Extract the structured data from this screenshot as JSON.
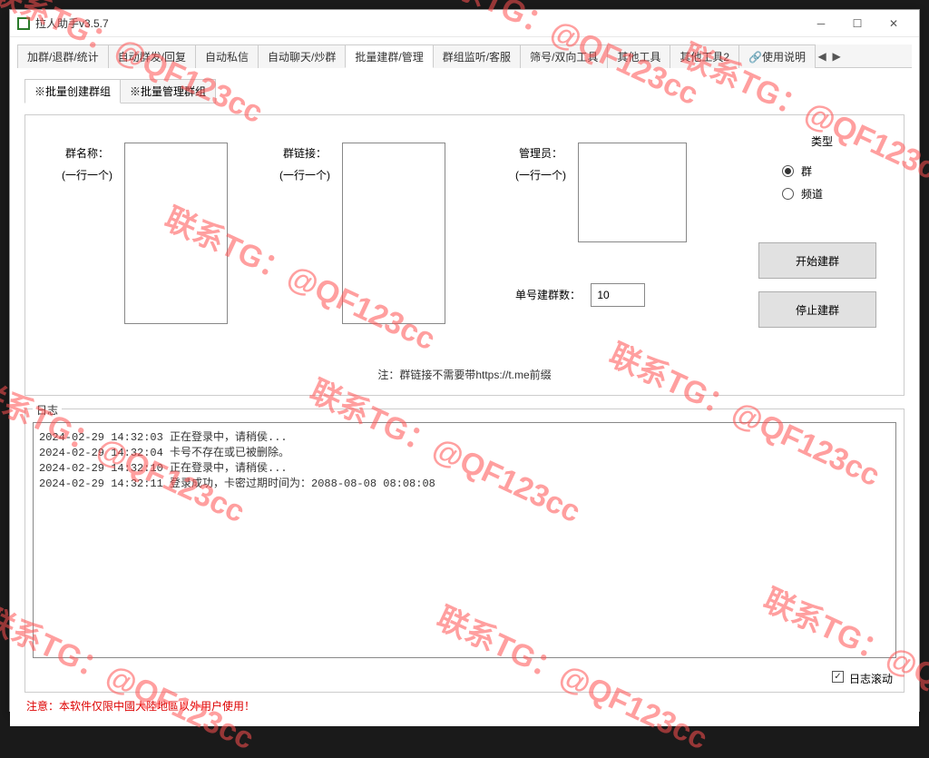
{
  "window": {
    "title": "拉人助手v3.5.7"
  },
  "tabs": [
    "加群/退群/统计",
    "自动群发/回复",
    "自动私信",
    "自动聊天/炒群",
    "批量建群/管理",
    "群组监听/客服",
    "筛号/双向工具",
    "其他工具",
    "其他工具2",
    "🔗使用说明"
  ],
  "subtabs": [
    "※批量创建群组",
    "※批量管理群组"
  ],
  "form": {
    "groupname_label": "群名称：",
    "groupname_hint": "(一行一个)",
    "link_label": "群链接：",
    "link_hint": "(一行一个)",
    "admin_label": "管理员：",
    "admin_hint": "(一行一个)",
    "count_label": "单号建群数：",
    "count_value": "10",
    "type_label": "类型",
    "type_group": "群",
    "type_channel": "频道",
    "start": "开始建群",
    "stop": "停止建群",
    "note": "注：群链接不需要带https://t.me前缀"
  },
  "log": {
    "title": "日志",
    "lines": "2024-02-29 14:32:03 正在登录中，请稍侯...\n2024-02-29 14:32:04 卡号不存在或已被删除。\n2024-02-29 14:32:10 正在登录中，请稍侯...\n2024-02-29 14:32:11 登录成功，卡密过期时间为：2088-08-08 08:08:08",
    "scroll": "日志滚动"
  },
  "warn": "注意：本软件仅限中國大陸地區以外用户使用！",
  "watermark": "联系TG：@QF123cc"
}
